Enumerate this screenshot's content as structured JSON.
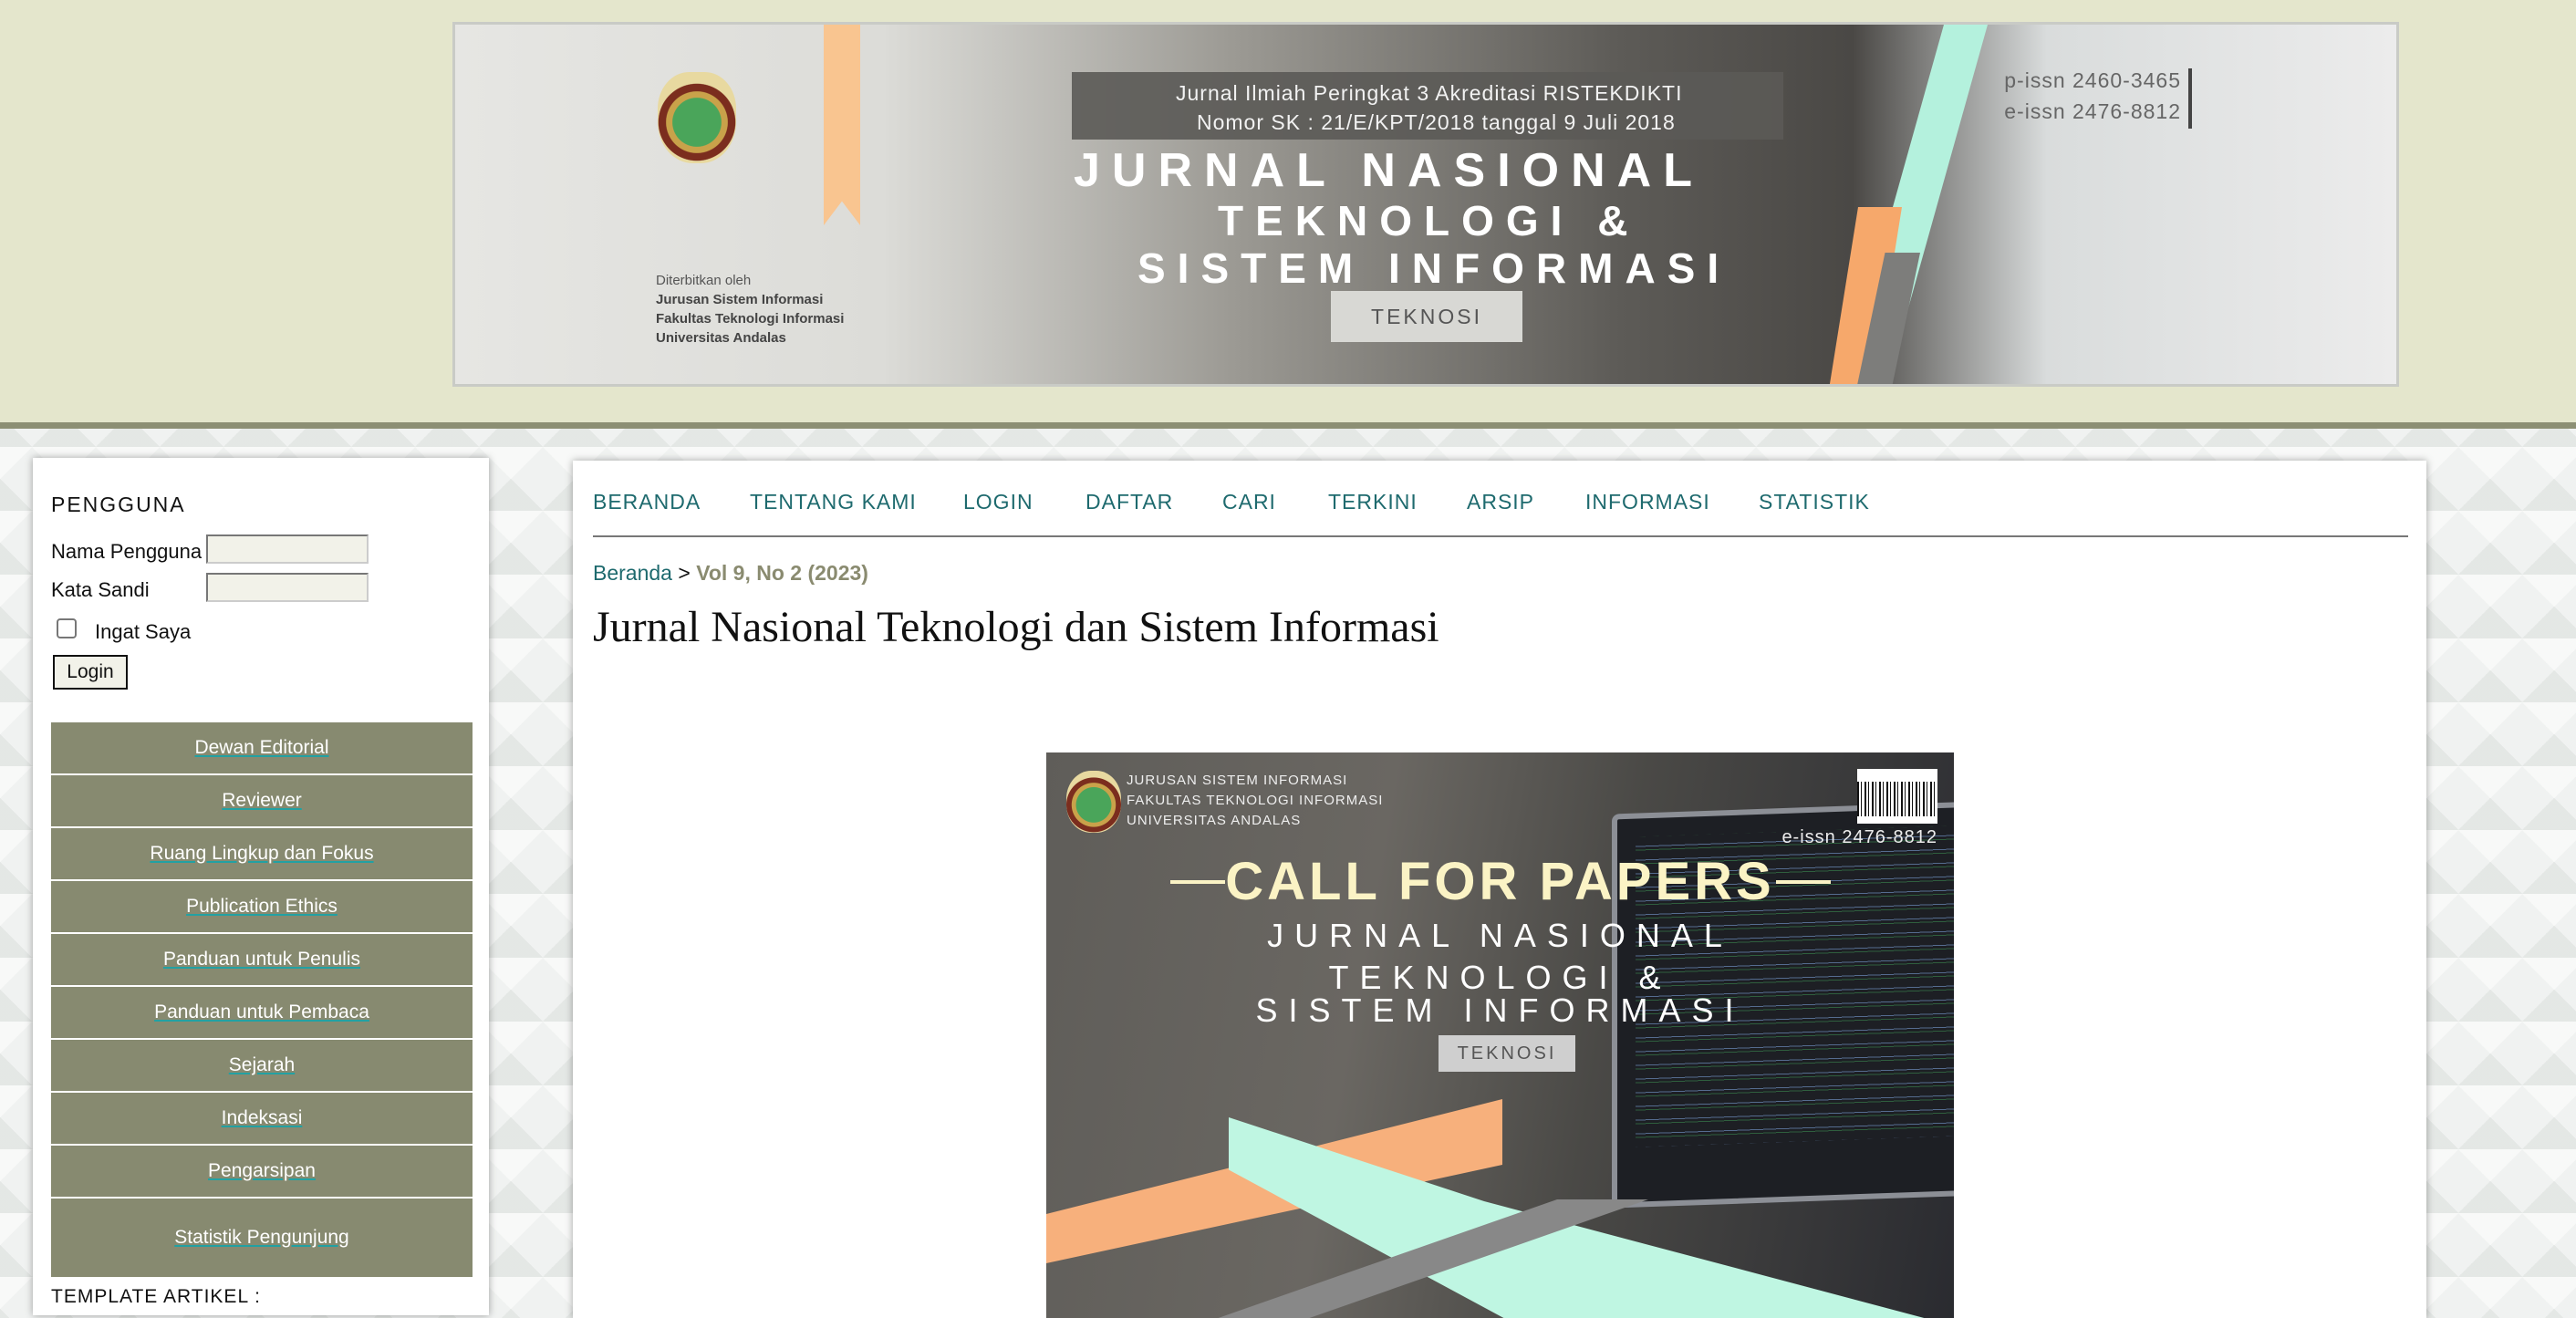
{
  "banner": {
    "accreditation_line1": "Jurnal Ilmiah Peringkat 3 Akreditasi RISTEKDIKTI",
    "accreditation_line2": "Nomor SK : 21/E/KPT/2018 tanggal 9 Juli 2018",
    "title_line1": "JURNAL NASIONAL",
    "title_line2": "TEKNOLOGI &",
    "title_line3": "SISTEM INFORMASI",
    "tag": "TEKNOSI",
    "publisher_intro": "Diterbitkan oleh",
    "publisher_dept": "Jurusan Sistem Informasi",
    "publisher_faculty": "Fakultas Teknologi Informasi",
    "publisher_university": "Universitas Andalas",
    "p_issn": "p-issn 2460-3465",
    "e_issn": "e-issn 2476-8812"
  },
  "sidebar": {
    "heading": "PENGGUNA",
    "username_label": "Nama Pengguna",
    "password_label": "Kata Sandi",
    "remember_label": "Ingat Saya",
    "login_button": "Login",
    "menu": [
      "Dewan Editorial",
      "Reviewer",
      "Ruang Lingkup dan Fokus",
      "Publication Ethics",
      "Panduan untuk Penulis",
      "Panduan untuk Pembaca",
      "Sejarah",
      "Indeksasi",
      "Pengarsipan",
      "Statistik Pengunjung"
    ],
    "template_label": "TEMPLATE ARTIKEL :"
  },
  "nav": [
    "BERANDA",
    "TENTANG KAMI",
    "LOGIN",
    "DAFTAR",
    "CARI",
    "TERKINI",
    "ARSIP",
    "INFORMASI",
    "STATISTIK"
  ],
  "breadcrumb": {
    "home": "Beranda",
    "separator": ">",
    "current": "Vol 9, No 2 (2023)"
  },
  "page_title": "Jurnal Nasional Teknologi dan Sistem Informasi",
  "cover": {
    "affil1": "JURUSAN SISTEM INFORMASI",
    "affil2": "FAKULTAS TEKNOLOGI INFORMASI",
    "affil3": "UNIVERSITAS ANDALAS",
    "e_issn": "e-issn 2476-8812",
    "headline": "CALL FOR PAPERS",
    "line1": "JURNAL NASIONAL",
    "line2": "TEKNOLOGI &",
    "line3": "SISTEM INFORMASI",
    "tag": "TEKNOSI"
  },
  "colors": {
    "header_band": "#e4e6cc",
    "sidebar_menu": "#878a70",
    "nav_link": "#1e6a6e",
    "breadcrumb_current": "#8a8b70"
  }
}
